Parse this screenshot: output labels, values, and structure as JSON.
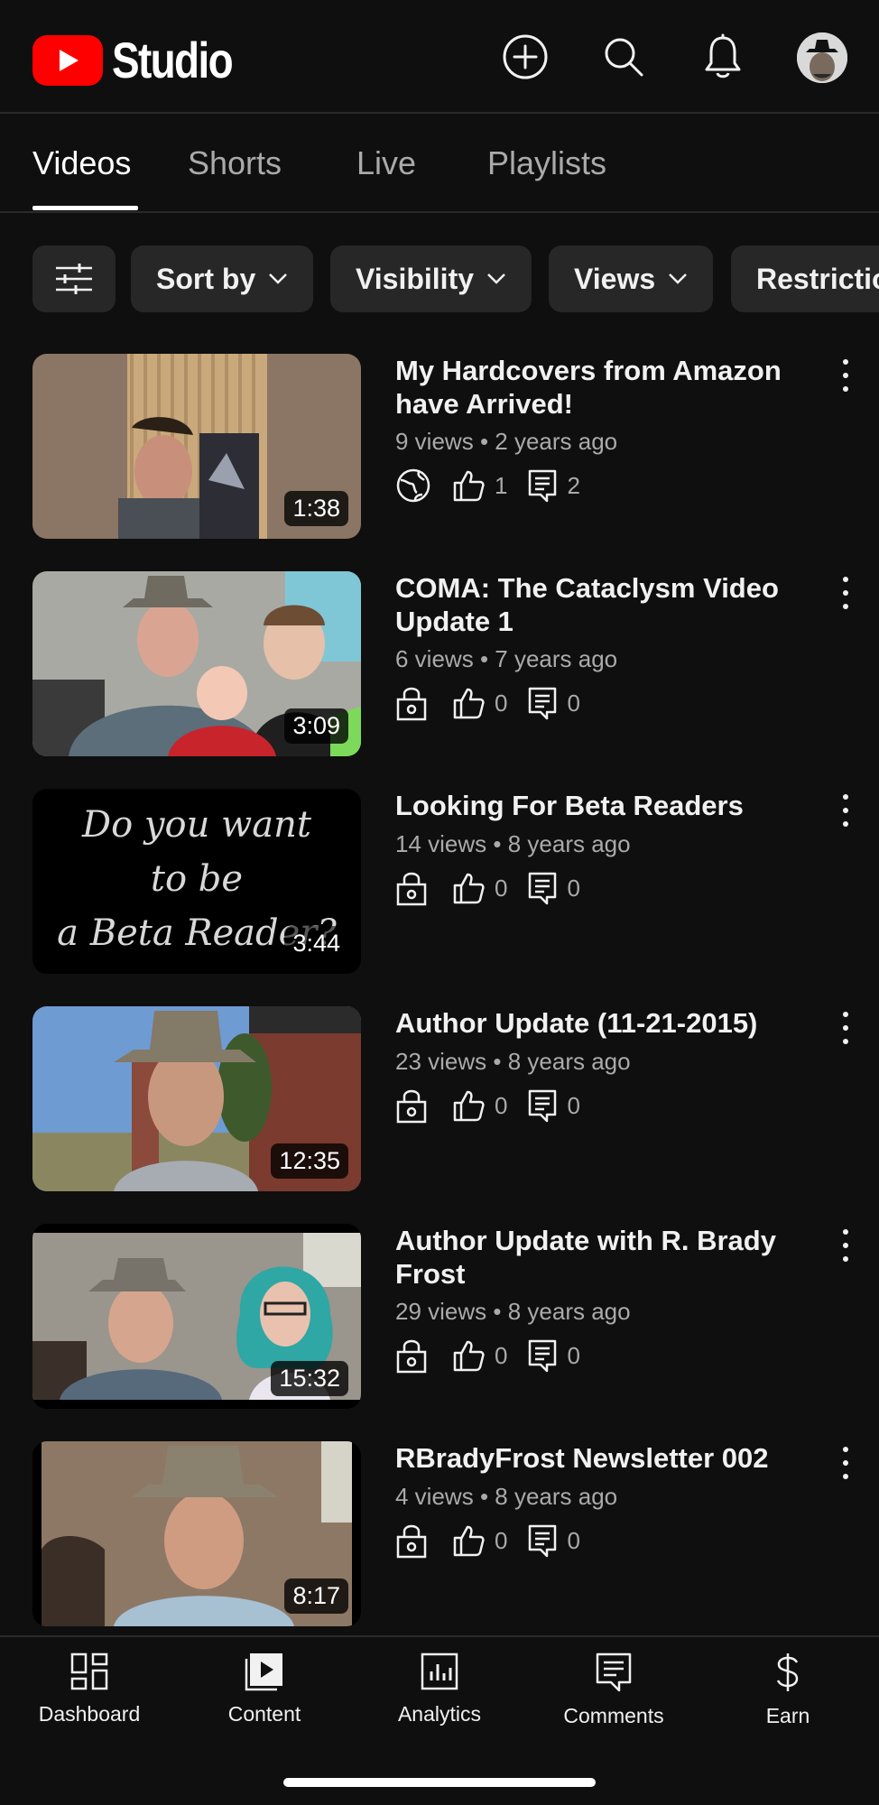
{
  "header": {
    "app_name": "Studio",
    "icons": [
      "create-icon",
      "search-icon",
      "notifications-icon",
      "account-avatar"
    ]
  },
  "tabs": [
    {
      "label": "Videos",
      "active": true
    },
    {
      "label": "Shorts",
      "active": false
    },
    {
      "label": "Live",
      "active": false
    },
    {
      "label": "Playlists",
      "active": false
    }
  ],
  "filters": {
    "sort": "Sort by",
    "visibility": "Visibility",
    "views": "Views",
    "restrictions": "Restrictions"
  },
  "videos": [
    {
      "title": "My Hardcovers from Amazon have Arrived!",
      "views": "9 views",
      "age": "2 years ago",
      "duration": "1:38",
      "visibility_icon": "public-globe-icon",
      "likes": "1",
      "comments": "2"
    },
    {
      "title": "COMA: The Cataclysm Video Update 1",
      "views": "6 views",
      "age": "7 years ago",
      "duration": "3:09",
      "visibility_icon": "private-lock-icon",
      "likes": "0",
      "comments": "0"
    },
    {
      "title": "Looking For Beta Readers",
      "views": "14 views",
      "age": "8 years ago",
      "duration": "3:44",
      "visibility_icon": "private-lock-icon",
      "likes": "0",
      "comments": "0",
      "thumb_text_1": "Do you want",
      "thumb_text_2": "to be",
      "thumb_text_3": "a Beta Reader?"
    },
    {
      "title": "Author Update (11-21-2015)",
      "views": "23 views",
      "age": "8 years ago",
      "duration": "12:35",
      "visibility_icon": "private-lock-icon",
      "likes": "0",
      "comments": "0"
    },
    {
      "title": "Author Update with R. Brady Frost",
      "views": "29 views",
      "age": "8 years ago",
      "duration": "15:32",
      "visibility_icon": "private-lock-icon",
      "likes": "0",
      "comments": "0"
    },
    {
      "title": "RBradyFrost Newsletter 002",
      "views": "4 views",
      "age": "8 years ago",
      "duration": "8:17",
      "visibility_icon": "private-lock-icon",
      "likes": "0",
      "comments": "0"
    }
  ],
  "meta_separator": "•",
  "bottom_nav": [
    {
      "label": "Dashboard",
      "icon": "dashboard-icon",
      "active": false
    },
    {
      "label": "Content",
      "icon": "content-icon",
      "active": true
    },
    {
      "label": "Analytics",
      "icon": "analytics-icon",
      "active": false
    },
    {
      "label": "Comments",
      "icon": "comments-icon",
      "active": false
    },
    {
      "label": "Earn",
      "icon": "earn-dollar-icon",
      "active": false
    }
  ],
  "colors": {
    "background": "#0f0f0f",
    "chip": "#272727",
    "brand_red": "#ff0000",
    "secondary_text": "#aaaaaa"
  }
}
